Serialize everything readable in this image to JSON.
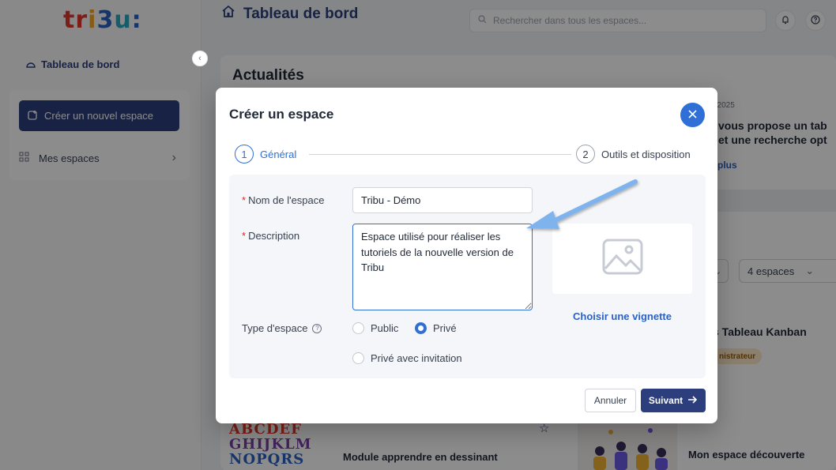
{
  "app": {
    "logo_text": "tribu:",
    "sidebar": {
      "dashboard_label": "Tableau de bord",
      "create_space_label": "Créer un nouvel espace",
      "my_spaces_label": "Mes espaces"
    },
    "header": {
      "title": "Tableau de bord",
      "search_placeholder": "Rechercher dans tous les espaces..."
    },
    "main": {
      "news_title": "Actualités",
      "news_date_fragment": "t 2025",
      "news_text_line1": "vous propose un tab",
      "news_text_line2": "et une recherche opt",
      "news_more": "plus",
      "filter_spaces": "4 espaces",
      "kanban_title": "s Tableau Kanban",
      "admin_badge": "nistrateur",
      "card1_title": "Module apprendre en dessinant",
      "card1_image_letters": [
        "ABCDEF",
        "GHIJKLM",
        "NOPQRS"
      ],
      "card2_title": "Mon espace découverte"
    }
  },
  "modal": {
    "title": "Créer un espace",
    "steps": [
      {
        "number": "1",
        "label": "Général",
        "active": true
      },
      {
        "number": "2",
        "label": "Outils et disposition",
        "active": false
      }
    ],
    "fields": {
      "name_label": "Nom de l'espace",
      "name_value": "Tribu - Démo",
      "description_label": "Description",
      "description_value": "Espace utilisé pour réaliser les tutoriels de la nouvelle version de Tribu",
      "type_label": "Type d'espace",
      "required_marker": "*"
    },
    "space_types": [
      {
        "label": "Public",
        "selected": false
      },
      {
        "label": "Privé",
        "selected": true
      },
      {
        "label": "Privé avec invitation",
        "selected": false
      }
    ],
    "thumbnail_link": "Choisir une vignette",
    "cancel_label": "Annuler",
    "next_label": "Suivant"
  },
  "colors": {
    "primary": "#2c3e7c",
    "accent": "#2f6fd6",
    "required": "#dc2626",
    "annotation_arrow": "#7fb3ee"
  }
}
